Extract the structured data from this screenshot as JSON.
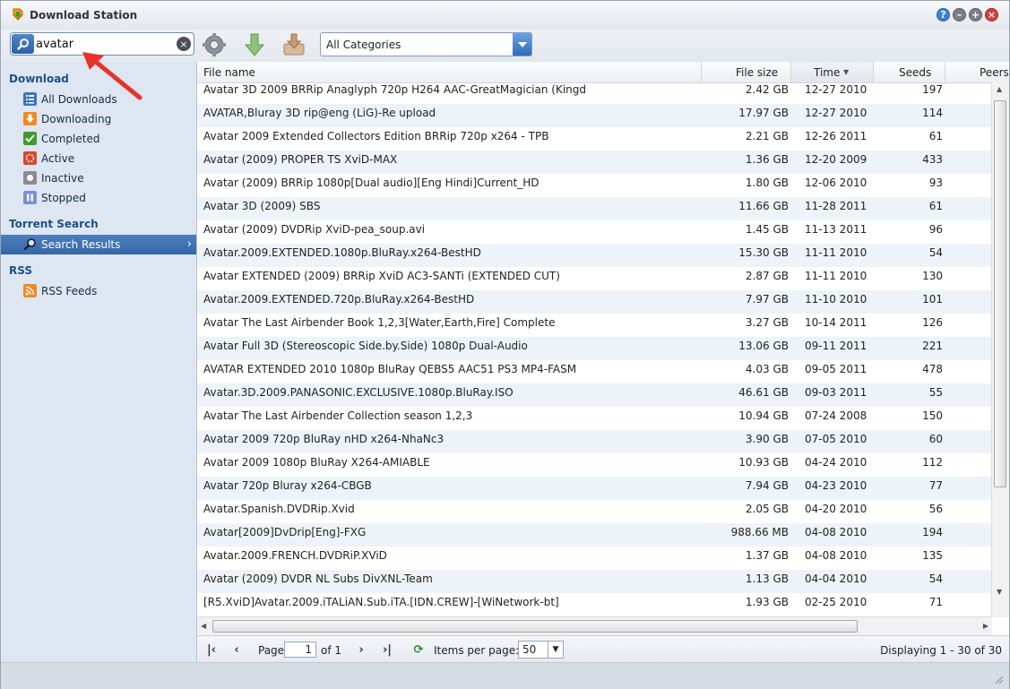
{
  "window": {
    "title": "Download Station"
  },
  "toolbar": {
    "search_value": "avatar",
    "category": "All Categories"
  },
  "sidebar": {
    "download_title": "Download",
    "download_items": [
      {
        "label": "All Downloads",
        "icon": "list-icon",
        "color": "#3d72c4"
      },
      {
        "label": "Downloading",
        "icon": "download-arrow-icon",
        "color": "#f08a1c"
      },
      {
        "label": "Completed",
        "icon": "checkmark-icon",
        "color": "#3f9a2c"
      },
      {
        "label": "Active",
        "icon": "active-dots-icon",
        "color": "#d9472b"
      },
      {
        "label": "Inactive",
        "icon": "inactive-dot-icon",
        "color": "#8c8c8c"
      },
      {
        "label": "Stopped",
        "icon": "pause-icon",
        "color": "#7b8fd6"
      }
    ],
    "torrent_title": "Torrent Search",
    "search_results_label": "Search Results",
    "rss_title": "RSS",
    "rss_feeds_label": "RSS Feeds"
  },
  "table": {
    "columns": {
      "name": "File name",
      "size": "File size",
      "time": "Time",
      "seeds": "Seeds",
      "peers": "Peers"
    },
    "rows": [
      {
        "name": "Avatar 3D 2009 BRRip Anaglyph 720p H264 AAC-GreatMagician (Kingd",
        "size": "2.42 GB",
        "time": "12-27 2010",
        "seeds": "197"
      },
      {
        "name": "AVATAR,Bluray 3D rip@eng (LiG)-Re upload",
        "size": "17.97 GB",
        "time": "12-27 2010",
        "seeds": "114"
      },
      {
        "name": "Avatar 2009 Extended Collectors Edition BRRip 720p x264 - TPB",
        "size": "2.21 GB",
        "time": "12-26 2011",
        "seeds": "61"
      },
      {
        "name": "Avatar (2009) PROPER TS XviD-MAX",
        "size": "1.36 GB",
        "time": "12-20 2009",
        "seeds": "433"
      },
      {
        "name": "Avatar (2009) BRRip 1080p[Dual audio][Eng Hindi]Current_HD",
        "size": "1.80 GB",
        "time": "12-06 2010",
        "seeds": "93"
      },
      {
        "name": "Avatar 3D (2009) SBS",
        "size": "11.66 GB",
        "time": "11-28 2011",
        "seeds": "61"
      },
      {
        "name": "Avatar (2009) DVDRip XviD-pea_soup.avi",
        "size": "1.45 GB",
        "time": "11-13 2011",
        "seeds": "96"
      },
      {
        "name": "Avatar.2009.EXTENDED.1080p.BluRay.x264-BestHD",
        "size": "15.30 GB",
        "time": "11-11 2010",
        "seeds": "54"
      },
      {
        "name": "Avatar EXTENDED (2009) BRRip XviD AC3-SANTi (EXTENDED CUT)",
        "size": "2.87 GB",
        "time": "11-11 2010",
        "seeds": "130"
      },
      {
        "name": "Avatar.2009.EXTENDED.720p.BluRay.x264-BestHD",
        "size": "7.97 GB",
        "time": "11-10 2010",
        "seeds": "101"
      },
      {
        "name": "Avatar The Last Airbender Book 1,2,3[Water,Earth,Fire] Complete",
        "size": "3.27 GB",
        "time": "10-14 2011",
        "seeds": "126"
      },
      {
        "name": "Avatar Full 3D (Stereoscopic Side.by.Side) 1080p Dual-Audio",
        "size": "13.06 GB",
        "time": "09-11 2011",
        "seeds": "221"
      },
      {
        "name": "AVATAR EXTENDED 2010 1080p BluRay QEBS5 AAC51 PS3 MP4-FASM",
        "size": "4.03 GB",
        "time": "09-05 2011",
        "seeds": "478"
      },
      {
        "name": "Avatar.3D.2009.PANASONIC.EXCLUSIVE.1080p.BluRay.ISO",
        "size": "46.61 GB",
        "time": "09-03 2011",
        "seeds": "55"
      },
      {
        "name": "Avatar The Last Airbender Collection season 1,2,3",
        "size": "10.94 GB",
        "time": "07-24 2008",
        "seeds": "150"
      },
      {
        "name": "Avatar 2009 720p BluRay nHD x264-NhaNc3",
        "size": "3.90 GB",
        "time": "07-05 2010",
        "seeds": "60"
      },
      {
        "name": "Avatar 2009 1080p BluRay X264-AMIABLE",
        "size": "10.93 GB",
        "time": "04-24 2010",
        "seeds": "112"
      },
      {
        "name": "Avatar 720p Bluray x264-CBGB",
        "size": "7.94 GB",
        "time": "04-23 2010",
        "seeds": "77"
      },
      {
        "name": "Avatar.Spanish.DVDRip.Xvid",
        "size": "2.05 GB",
        "time": "04-20 2010",
        "seeds": "56"
      },
      {
        "name": "Avatar[2009]DvDrip[Eng]-FXG",
        "size": "988.66 MB",
        "time": "04-08 2010",
        "seeds": "194"
      },
      {
        "name": "Avatar.2009.FRENCH.DVDRiP.XViD",
        "size": "1.37 GB",
        "time": "04-08 2010",
        "seeds": "135"
      },
      {
        "name": "Avatar (2009) DVDR NL Subs DivXNL-Team",
        "size": "1.13 GB",
        "time": "04-04 2010",
        "seeds": "54"
      },
      {
        "name": "[R5.XviD]Avatar.2009.iTALiAN.Sub.iTA.[IDN.CREW]-[WiNetwork-bt]",
        "size": "1.93 GB",
        "time": "02-25 2010",
        "seeds": "71"
      }
    ]
  },
  "pager": {
    "page_label": "Page",
    "page_value": "1",
    "of_label": "of 1",
    "items_per_page_label": "Items per page:",
    "items_per_page_value": "50",
    "displaying": "Displaying 1 - 30 of 30"
  }
}
